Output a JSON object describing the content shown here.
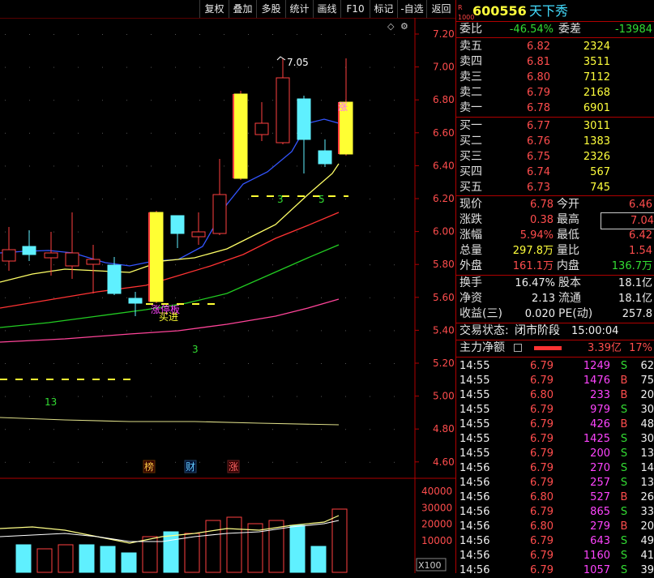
{
  "toolbar": {
    "buttons": [
      "复权",
      "叠加",
      "多股",
      "统计",
      "画线",
      "F10",
      "标记",
      "-自选",
      "返回"
    ]
  },
  "stock": {
    "code": "600556",
    "name": "天下秀",
    "badge_r": "R",
    "badge_num": "1000"
  },
  "order_ratio": {
    "label": "委比",
    "value": "-46.54%",
    "diff_label": "委差",
    "diff_value": "-13984"
  },
  "asks": [
    {
      "label": "卖五",
      "price": "6.82",
      "volume": "2324"
    },
    {
      "label": "卖四",
      "price": "6.81",
      "volume": "3511"
    },
    {
      "label": "卖三",
      "price": "6.80",
      "volume": "7112"
    },
    {
      "label": "卖二",
      "price": "6.79",
      "volume": "2168"
    },
    {
      "label": "卖一",
      "price": "6.78",
      "volume": "6901"
    }
  ],
  "bids": [
    {
      "label": "买一",
      "price": "6.77",
      "volume": "3011"
    },
    {
      "label": "买二",
      "price": "6.76",
      "volume": "1383"
    },
    {
      "label": "买三",
      "price": "6.75",
      "volume": "2326"
    },
    {
      "label": "买四",
      "price": "6.74",
      "volume": "567"
    },
    {
      "label": "买五",
      "price": "6.73",
      "volume": "745"
    }
  ],
  "quote": [
    {
      "l1": "现价",
      "v1": "6.78",
      "c1": "red",
      "l2": "今开",
      "v2": "6.46",
      "c2": "red"
    },
    {
      "l1": "涨跌",
      "v1": "0.38",
      "c1": "red",
      "l2": "最高",
      "v2": "7.04",
      "c2": "red"
    },
    {
      "l1": "涨幅",
      "v1": "5.94%",
      "c1": "red",
      "l2": "最低",
      "v2": "6.42",
      "c2": "red"
    },
    {
      "l1": "总量",
      "v1": "297.8万",
      "c1": "yellow",
      "l2": "量比",
      "v2": "1.54",
      "c2": "red"
    },
    {
      "l1": "外盘",
      "v1": "161.1万",
      "c1": "red",
      "l2": "内盘",
      "v2": "136.7万",
      "c2": "green"
    }
  ],
  "fundamentals": [
    {
      "l1": "换手",
      "v1": "16.47%",
      "l2": "股本",
      "v2": "18.1亿"
    },
    {
      "l1": "净资",
      "v1": "2.13",
      "l2": "流通",
      "v2": "18.1亿"
    },
    {
      "l1": "收益(三)",
      "v1": "0.020",
      "l2": "PE(动)",
      "v2": "257.8"
    }
  ],
  "trade_status": {
    "label": "交易状态:",
    "phase": "闭市阶段",
    "time": "15:00:04"
  },
  "main_net": {
    "label": "主力净额",
    "value": "3.39亿",
    "pct": "17%"
  },
  "trades": [
    {
      "time": "14:55",
      "price": "6.79",
      "vol": "1249",
      "dir": "S",
      "cnt": "62"
    },
    {
      "time": "14:55",
      "price": "6.79",
      "vol": "1476",
      "dir": "B",
      "cnt": "75"
    },
    {
      "time": "14:55",
      "price": "6.80",
      "vol": "233",
      "dir": "B",
      "cnt": "20"
    },
    {
      "time": "14:55",
      "price": "6.79",
      "vol": "979",
      "dir": "S",
      "cnt": "30"
    },
    {
      "time": "14:55",
      "price": "6.79",
      "vol": "426",
      "dir": "B",
      "cnt": "48"
    },
    {
      "time": "14:55",
      "price": "6.79",
      "vol": "1425",
      "dir": "S",
      "cnt": "30"
    },
    {
      "time": "14:55",
      "price": "6.79",
      "vol": "200",
      "dir": "S",
      "cnt": "13"
    },
    {
      "time": "14:56",
      "price": "6.79",
      "vol": "270",
      "dir": "S",
      "cnt": "14"
    },
    {
      "time": "14:56",
      "price": "6.79",
      "vol": "257",
      "dir": "S",
      "cnt": "13"
    },
    {
      "time": "14:56",
      "price": "6.80",
      "vol": "527",
      "dir": "B",
      "cnt": "26"
    },
    {
      "time": "14:56",
      "price": "6.79",
      "vol": "865",
      "dir": "S",
      "cnt": "33"
    },
    {
      "time": "14:56",
      "price": "6.80",
      "vol": "279",
      "dir": "B",
      "cnt": "20"
    },
    {
      "time": "14:56",
      "price": "6.79",
      "vol": "643",
      "dir": "S",
      "cnt": "49"
    },
    {
      "time": "14:56",
      "price": "6.79",
      "vol": "1160",
      "dir": "S",
      "cnt": "41"
    },
    {
      "time": "14:56",
      "price": "6.79",
      "vol": "1057",
      "dir": "S",
      "cnt": "39"
    }
  ],
  "chart": {
    "price_ticks": [
      "7.20",
      "7.00",
      "6.80",
      "6.60",
      "6.40",
      "6.20",
      "6.00",
      "5.80",
      "5.60",
      "5.40",
      "5.20",
      "5.00",
      "4.80",
      "4.60"
    ],
    "vol_ticks": [
      "40000",
      "30000",
      "20000",
      "10000"
    ],
    "vol_unit": "X100",
    "high_label": "7.05",
    "buy_signal": "买进",
    "limit_up_label": "涨停板",
    "count_labels": [
      "3",
      "3",
      "5",
      "13"
    ],
    "event_tags": [
      "榜",
      "财",
      "涨"
    ],
    "bar_tag": "涨"
  }
}
